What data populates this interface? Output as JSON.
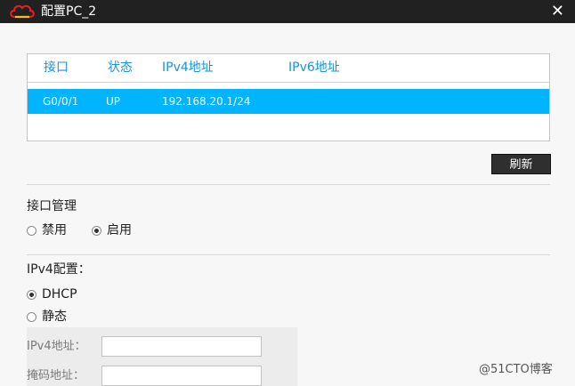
{
  "window": {
    "title": "配置PC_2",
    "close_glyph": "✕"
  },
  "interfaces": {
    "headers": {
      "interface": "接口",
      "status": "状态",
      "ipv4": "IPv4地址",
      "ipv6": "IPv6地址"
    },
    "rows": [
      {
        "interface": "G0/0/1",
        "status": "UP",
        "ipv4": "192.168.20.1/24",
        "ipv6": ""
      }
    ]
  },
  "refresh_label": "刷新",
  "interface_management": {
    "label": "接口管理",
    "options": [
      {
        "label": "禁用",
        "selected": false
      },
      {
        "label": "启用",
        "selected": true
      }
    ]
  },
  "ipv4_config": {
    "label": "IPv4配置：",
    "options": [
      {
        "label": "DHCP",
        "selected": true
      },
      {
        "label": "静态",
        "selected": false
      }
    ],
    "fields": [
      {
        "label": "IPv4地址：",
        "value": ""
      },
      {
        "label": "掩码地址：",
        "value": ""
      }
    ]
  },
  "watermark": "@51CTO博客",
  "colors": {
    "titlebar": "#212121",
    "selection": "#00b4ff",
    "header_text": "#1a94d8"
  }
}
